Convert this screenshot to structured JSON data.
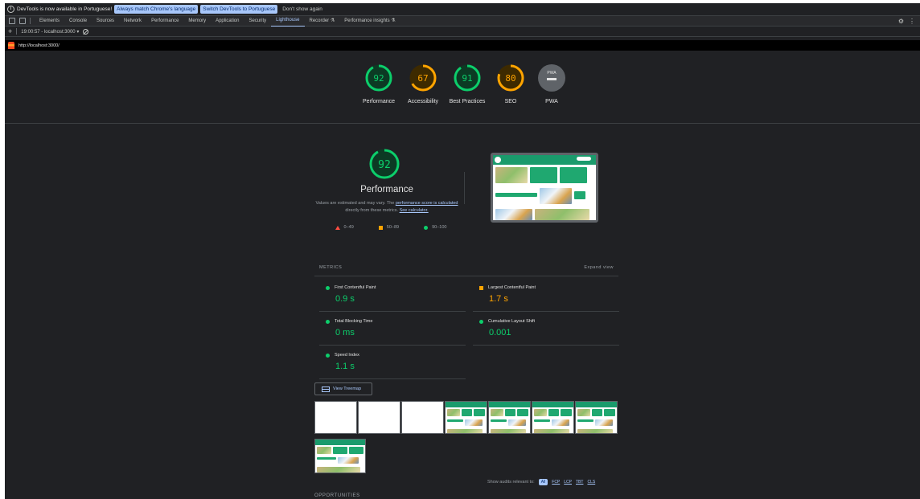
{
  "infobar": {
    "message": "DevTools is now available in Portuguese!",
    "btn_match": "Always match Chrome's language",
    "btn_switch": "Switch DevTools to Portuguese",
    "btn_dismiss": "Don't show again"
  },
  "tabs": [
    {
      "label": "Elements"
    },
    {
      "label": "Console"
    },
    {
      "label": "Sources"
    },
    {
      "label": "Network"
    },
    {
      "label": "Performance"
    },
    {
      "label": "Memory"
    },
    {
      "label": "Application"
    },
    {
      "label": "Security"
    },
    {
      "label": "Lighthouse"
    },
    {
      "label": "Recorder ⚗"
    },
    {
      "label": "Performance insights ⚗"
    }
  ],
  "toolbar": {
    "report_selector": "19:00:57 - localhost:3000 ▾"
  },
  "urlbar": {
    "url": "http://localhost:3000/"
  },
  "gauges": [
    {
      "score": "92",
      "label": "Performance",
      "color": "#0cce6b"
    },
    {
      "score": "67",
      "label": "Accessibility",
      "color": "#ffa400"
    },
    {
      "score": "91",
      "label": "Best Practices",
      "color": "#0cce6b"
    },
    {
      "score": "80",
      "label": "SEO",
      "color": "#ffa400"
    },
    {
      "score": "PWA",
      "label": "PWA",
      "color": "#5f6368"
    }
  ],
  "performance": {
    "score": "92",
    "title": "Performance",
    "desc_prefix": "Values are estimated and may vary. The ",
    "desc_link": "performance score is calculated",
    "desc_mid": " directly from these metrics. ",
    "desc_link2": "See calculator.",
    "legend": {
      "fail": "0–49",
      "average": "50–89",
      "pass": "90–100"
    }
  },
  "metrics": {
    "header": "METRICS",
    "expand": "Expand view",
    "items": [
      {
        "name": "First Contentful Paint",
        "value": "0.9 s",
        "status": "pass"
      },
      {
        "name": "Largest Contentful Paint",
        "value": "1.7 s",
        "status": "average"
      },
      {
        "name": "Total Blocking Time",
        "value": "0 ms",
        "status": "pass"
      },
      {
        "name": "Cumulative Layout Shift",
        "value": "0.001",
        "status": "pass"
      },
      {
        "name": "Speed Index",
        "value": "1.1 s",
        "status": "pass"
      }
    ]
  },
  "treemap": {
    "label": "View Treemap"
  },
  "audits_filter": {
    "label": "Show audits relevant to:",
    "chips": [
      "All",
      "FCP",
      "LCP",
      "TBT",
      "CLS"
    ]
  },
  "opportunities": {
    "label": "OPPORTUNITIES"
  },
  "colors": {
    "pass": "#0cce6b",
    "average": "#ffa400",
    "fail": "#ff4e42",
    "accent": "#a8c7fa"
  }
}
